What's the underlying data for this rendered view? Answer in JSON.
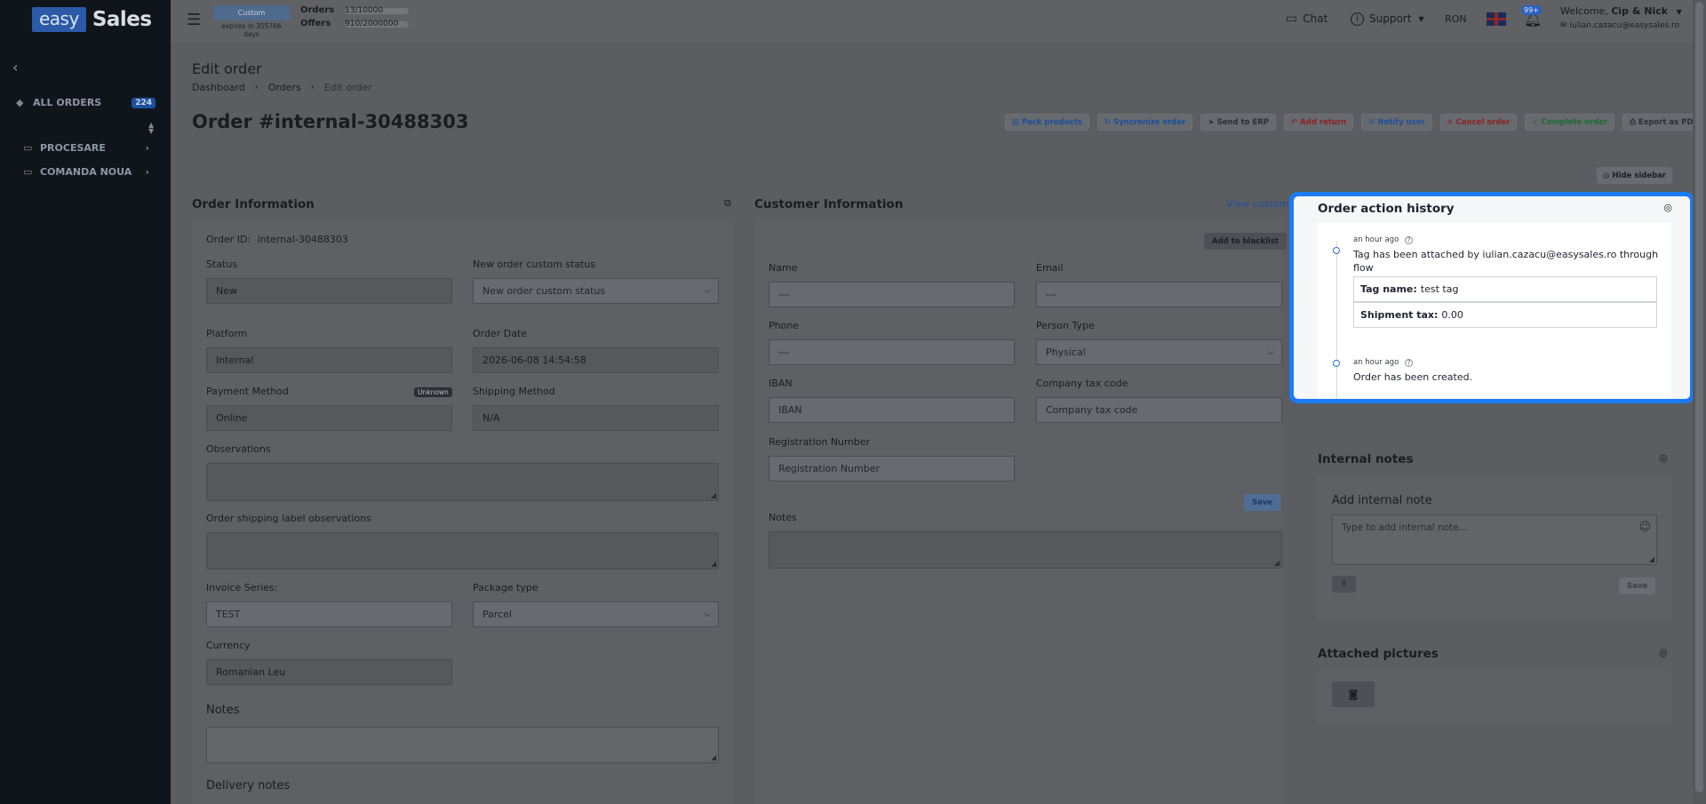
{
  "app": {
    "logo_easy": "easy",
    "logo_sales": "Sales"
  },
  "sidebar": {
    "back_icon": "chevron-left-icon",
    "items": [
      {
        "label": "ALL ORDERS",
        "badge": "224",
        "icon": "tag-icon"
      },
      {
        "label": "PROCESARE",
        "icon": "folder-icon"
      },
      {
        "label": "COMANDA NOUA",
        "icon": "folder-icon"
      }
    ]
  },
  "topbar": {
    "plan": {
      "name": "Custom",
      "expires": "expires in 355766 days"
    },
    "orders_label": "Orders",
    "orders_value": "13/10000",
    "offers_label": "Offers",
    "offers_value": "910/2000000",
    "chat": "Chat",
    "support": "Support",
    "currency": "RON",
    "notifications_badge": "99+",
    "welcome_prefix": "Welcome,",
    "welcome_name": "Cip & Nick",
    "email": "iulian.cazacu@easysales.ro"
  },
  "page": {
    "heading": "Edit order",
    "breadcrumb": [
      "Dashboard",
      "Orders",
      "Edit order"
    ],
    "order_title": "Order #internal-30488303",
    "actions": [
      {
        "label": "Pack products",
        "icon": "▤",
        "color": "blue"
      },
      {
        "label": "Syncronize order",
        "icon": "↻",
        "color": "blue"
      },
      {
        "label": "Send to ERP",
        "icon": "➤",
        "color": "grey"
      },
      {
        "label": "Add return",
        "icon": "↶",
        "color": "red"
      },
      {
        "label": "Notify user",
        "icon": "✉",
        "color": "blue"
      },
      {
        "label": "Cancel order",
        "icon": "✕",
        "color": "red"
      },
      {
        "label": "Complete order",
        "icon": "✓",
        "color": "green"
      },
      {
        "label": "Export as PDF",
        "icon": "⎙",
        "color": "grey"
      }
    ],
    "hide_sidebar": "Hide sidebar"
  },
  "order_info": {
    "title": "Order Information",
    "order_id_label": "Order ID:",
    "order_id_value": "internal-30488303",
    "status_label": "Status",
    "status_value": "New",
    "custom_status_label": "New order custom status",
    "custom_status_value": "New order custom status",
    "platform_label": "Platform",
    "platform_value": "Internal",
    "order_date_label": "Order Date",
    "order_date_value": "2026-06-08 14:54:58",
    "payment_label": "Payment Method",
    "payment_badge": "Unknown",
    "payment_value": "Online",
    "shipping_label": "Shipping Method",
    "shipping_value": "N/A",
    "observations_label": "Observations",
    "shipping_obs_label": "Order shipping label observations",
    "invoice_series_label": "Invoice Series:",
    "invoice_series_value": "TEST",
    "package_type_label": "Package type",
    "package_type_value": "Parcel",
    "currency_label": "Currency",
    "currency_value": "Romanian Leu",
    "notes_label": "Notes",
    "delivery_notes_label": "Delivery notes"
  },
  "customer_info": {
    "title": "Customer Information",
    "view_customer": "View customer",
    "add_blacklist": "Add to blacklist",
    "name_label": "Name",
    "name_value": "---",
    "email_label": "Email",
    "email_value": "---",
    "phone_label": "Phone",
    "phone_value": "---",
    "person_type_label": "Person Type",
    "person_type_value": "Physical",
    "iban_label": "IBAN",
    "iban_placeholder": "IBAN",
    "tax_label": "Company tax code",
    "tax_placeholder": "Company tax code",
    "reg_label": "Registration Number",
    "reg_placeholder": "Registration Number",
    "save": "Save",
    "notes_label": "Notes"
  },
  "history": {
    "title": "Order action history",
    "entries": [
      {
        "time": "an hour ago",
        "text": "Tag has been attached by iulian.cazacu@easysales.ro through flow",
        "details": [
          {
            "key": "Tag name:",
            "value": "test tag"
          },
          {
            "key": "Shipment tax:",
            "value": "0.00"
          }
        ]
      },
      {
        "time": "an hour ago",
        "text": "Order has been created."
      }
    ]
  },
  "internal_notes": {
    "title": "Internal notes",
    "add_title": "Add internal note",
    "placeholder": "Type to add internal note...",
    "save": "Save"
  },
  "attached_pictures": {
    "title": "Attached pictures"
  }
}
